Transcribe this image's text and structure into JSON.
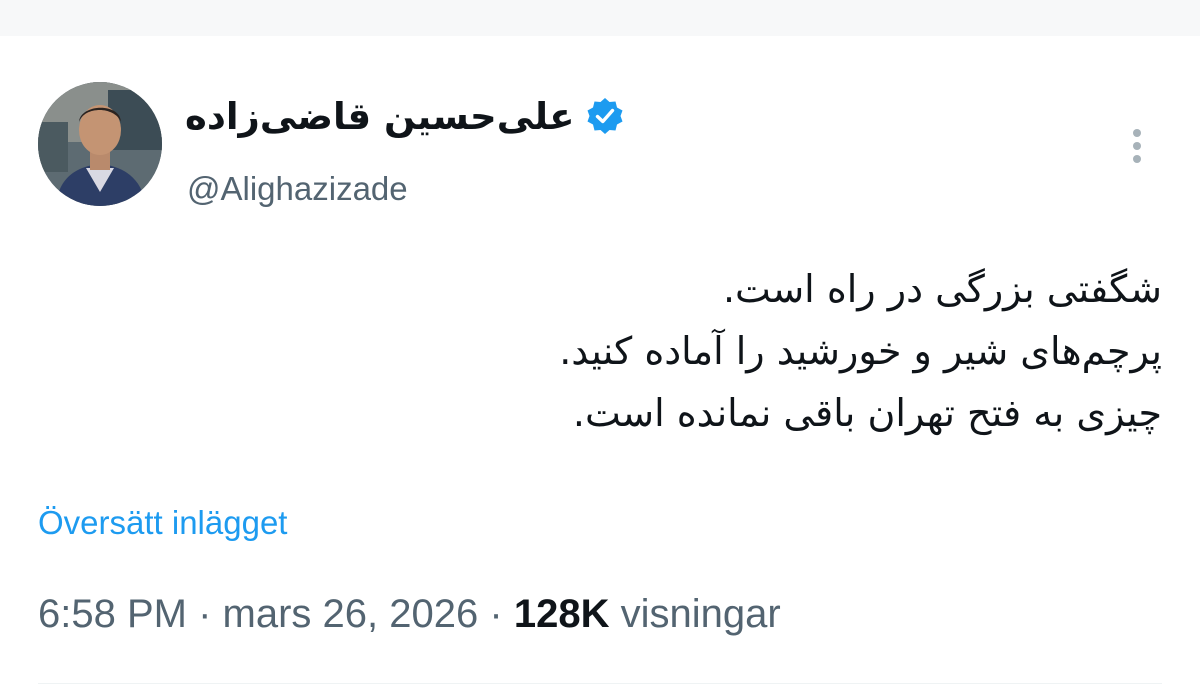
{
  "author": {
    "display_name": "علی‌حسین قاضی‌زاده",
    "handle": "@Alighazizade",
    "verified": true,
    "verified_color": "#1d9bf0"
  },
  "tweet": {
    "lines": [
      "شگفتی بزرگی در راه است.",
      "پرچم‌های شیر و خورشید را آماده کنید.",
      "چیزی به فتح تهران باقی نمانده است."
    ]
  },
  "translate_label": "Översätt inlägget",
  "meta": {
    "time": "6:58 PM",
    "separator": "·",
    "date": "mars 26, 2026",
    "views_count": "128K",
    "views_label": "visningar"
  },
  "icons": {
    "verified": "verified-badge-icon",
    "more": "more-options-icon"
  },
  "colors": {
    "link": "#1d9bf0",
    "secondary_text": "#536471",
    "primary_text": "#0f1419"
  }
}
